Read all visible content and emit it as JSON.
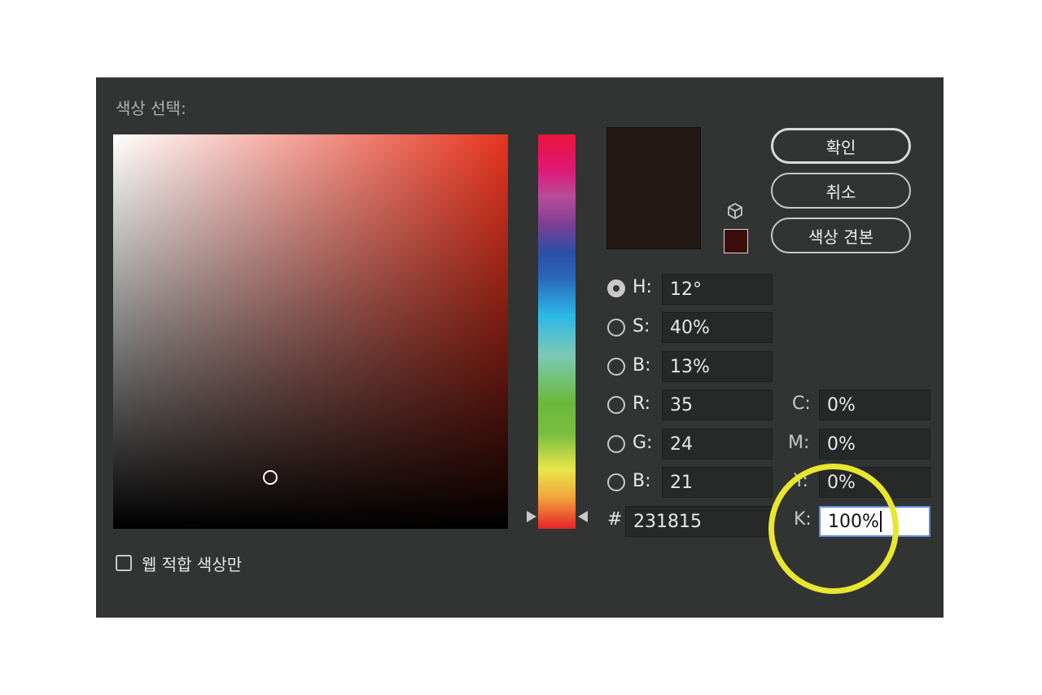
{
  "dialog": {
    "title": "색상 선택:"
  },
  "buttons": {
    "ok": "확인",
    "cancel": "취소",
    "swatches": "색상 견본"
  },
  "fields": {
    "h": {
      "label": "H:",
      "value": "12°"
    },
    "s": {
      "label": "S:",
      "value": "40%"
    },
    "bv": {
      "label": "B:",
      "value": "13%"
    },
    "r": {
      "label": "R:",
      "value": "35"
    },
    "g": {
      "label": "G:",
      "value": "24"
    },
    "b": {
      "label": "B:",
      "value": "21"
    },
    "hex": {
      "label": "#",
      "value": "231815"
    },
    "c": {
      "label": "C:",
      "value": "0%"
    },
    "m": {
      "label": "M:",
      "value": "0%"
    },
    "y": {
      "label": "Y:",
      "value": "0%"
    },
    "k": {
      "label": "K:",
      "value": "100%"
    }
  },
  "web_only": {
    "label": "웹 적합 색상만",
    "checked": false
  },
  "colors": {
    "new": "#231815",
    "current": "#3a0d0a",
    "highlight": "#e8e62e"
  },
  "selected_mode": "H",
  "icons": {
    "cube": "cube-icon"
  }
}
